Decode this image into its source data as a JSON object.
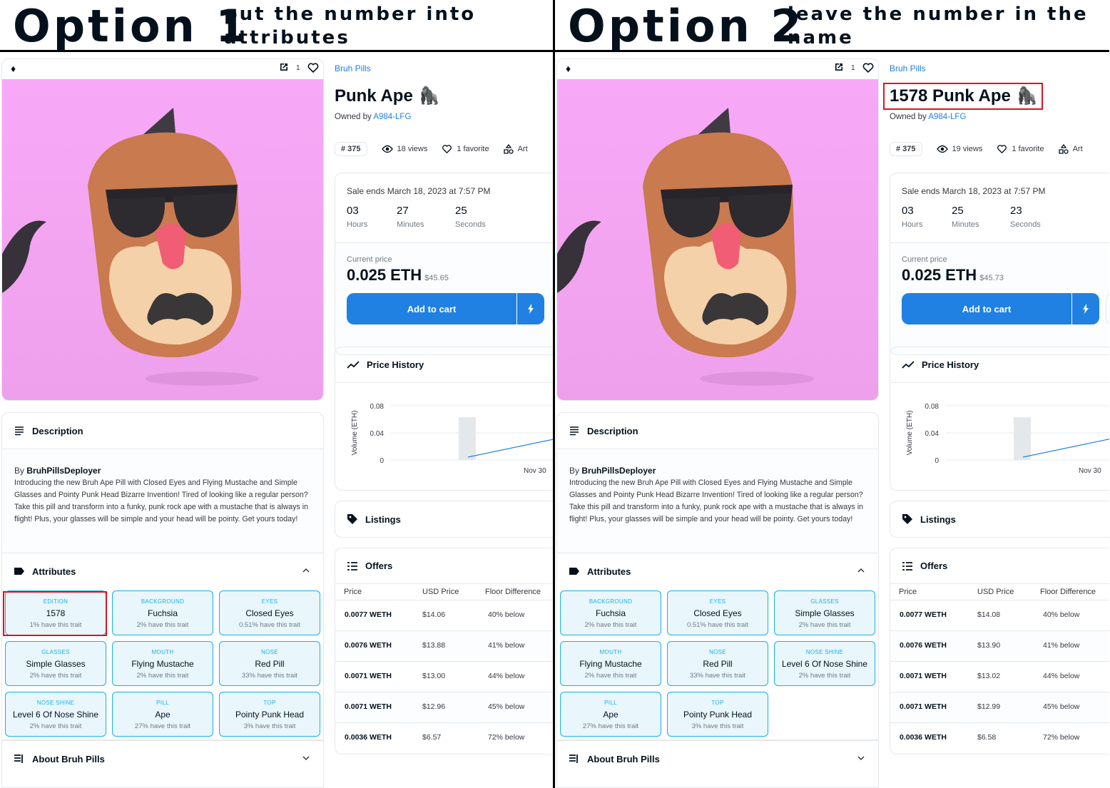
{
  "colors": {
    "accent": "#2081e2",
    "trait_border": "#15b2e5",
    "highlight": "#e0121f",
    "art_bg": "#f7a9f7"
  },
  "options": [
    {
      "title": "Option 1",
      "note": "put the number into attributes",
      "item": {
        "favorites_count": "1",
        "collection": "Bruh Pills",
        "name": "Punk Ape",
        "name_emoji": "🦍",
        "owned_by_label": "Owned by",
        "owner": "A984-LFG",
        "rank": "# 375",
        "views": "18 views",
        "favorites": "1 favorite",
        "category": "Art",
        "sale_ends": "Sale ends March 18, 2023 at 7:57 PM",
        "timer": [
          {
            "value": "03",
            "label": "Hours"
          },
          {
            "value": "27",
            "label": "Minutes"
          },
          {
            "value": "25",
            "label": "Seconds"
          }
        ],
        "current_price_label": "Current price",
        "current_price": "0.025 ETH",
        "current_price_usd": "$45.65",
        "add_to_cart": "Add to cart",
        "price_history": "Price History",
        "listings": "Listings",
        "offers": "Offers",
        "offer_columns": [
          "Price",
          "USD Price",
          "Floor Difference"
        ],
        "offer_rows": [
          {
            "price": "0.0077 WETH",
            "usd": "$14.06",
            "floor": "40% below"
          },
          {
            "price": "0.0076 WETH",
            "usd": "$13.88",
            "floor": "41% below"
          },
          {
            "price": "0.0071 WETH",
            "usd": "$13.00",
            "floor": "44% below"
          },
          {
            "price": "0.0071 WETH",
            "usd": "$12.96",
            "floor": "45% below"
          },
          {
            "price": "0.0036 WETH",
            "usd": "$6.57",
            "floor": "72% below"
          }
        ],
        "description_title": "Description",
        "by_label": "By",
        "creator": "BruhPillsDeployer",
        "description": "Introducing the new Bruh Ape Pill with Closed Eyes and Flying Mustache and Simple Glasses and Pointy Punk Head Bizarre Invention! Tired of looking like a regular person? Take this pill and transform into a funky, punk rock ape with a mustache that is always in flight! Plus, your glasses will be simple and your head will be pointy. Get yours today!",
        "attributes_title": "Attributes",
        "attributes": [
          {
            "type": "EDITION",
            "value": "1578",
            "rarity": "1% have this trait"
          },
          {
            "type": "BACKGROUND",
            "value": "Fuchsia",
            "rarity": "2% have this trait"
          },
          {
            "type": "EYES",
            "value": "Closed Eyes",
            "rarity": "0.51% have this trait"
          },
          {
            "type": "GLASSES",
            "value": "Simple Glasses",
            "rarity": "2% have this trait"
          },
          {
            "type": "MOUTH",
            "value": "Flying Mustache",
            "rarity": "2% have this trait"
          },
          {
            "type": "NOSE",
            "value": "Red Pill",
            "rarity": "33% have this trait"
          },
          {
            "type": "NOSE SHINE",
            "value": "Level 6 Of Nose Shine",
            "rarity": "2% have this trait"
          },
          {
            "type": "PILL",
            "value": "Ape",
            "rarity": "27% have this trait"
          },
          {
            "type": "TOP",
            "value": "Pointy Punk Head",
            "rarity": "3% have this trait"
          }
        ],
        "about_title": "About Bruh Pills"
      }
    },
    {
      "title": "Option 2",
      "note": "leave the number in the name",
      "item": {
        "favorites_count": "1",
        "collection": "Bruh Pills",
        "name": "1578  Punk Ape",
        "name_emoji": "🦍",
        "owned_by_label": "Owned by",
        "owner": "A984-LFG",
        "rank": "# 375",
        "views": "19 views",
        "favorites": "1 favorite",
        "category": "Art",
        "sale_ends": "Sale ends March 18, 2023 at 7:57 PM",
        "timer": [
          {
            "value": "03",
            "label": "Hours"
          },
          {
            "value": "25",
            "label": "Minutes"
          },
          {
            "value": "23",
            "label": "Seconds"
          }
        ],
        "current_price_label": "Current price",
        "current_price": "0.025 ETH",
        "current_price_usd": "$45.73",
        "add_to_cart": "Add to cart",
        "price_history": "Price History",
        "listings": "Listings",
        "offers": "Offers",
        "offer_columns": [
          "Price",
          "USD Price",
          "Floor Difference"
        ],
        "offer_rows": [
          {
            "price": "0.0077 WETH",
            "usd": "$14.08",
            "floor": "40% below"
          },
          {
            "price": "0.0076 WETH",
            "usd": "$13.90",
            "floor": "41% below"
          },
          {
            "price": "0.0071 WETH",
            "usd": "$13.02",
            "floor": "44% below"
          },
          {
            "price": "0.0071 WETH",
            "usd": "$12.99",
            "floor": "45% below"
          },
          {
            "price": "0.0036 WETH",
            "usd": "$6.58",
            "floor": "72% below"
          }
        ],
        "description_title": "Description",
        "by_label": "By",
        "creator": "BruhPillsDeployer",
        "description": "Introducing the new Bruh Ape Pill with Closed Eyes and Flying Mustache and Simple Glasses and Pointy Punk Head Bizarre Invention! Tired of looking like a regular person? Take this pill and transform into a funky, punk rock ape with a mustache that is always in flight! Plus, your glasses will be simple and your head will be pointy. Get yours today!",
        "attributes_title": "Attributes",
        "attributes": [
          {
            "type": "BACKGROUND",
            "value": "Fuchsia",
            "rarity": "2% have this trait"
          },
          {
            "type": "EYES",
            "value": "Closed Eyes",
            "rarity": "0.51% have this trait"
          },
          {
            "type": "GLASSES",
            "value": "Simple Glasses",
            "rarity": "2% have this trait"
          },
          {
            "type": "MOUTH",
            "value": "Flying Mustache",
            "rarity": "2% have this trait"
          },
          {
            "type": "NOSE",
            "value": "Red Pill",
            "rarity": "33% have this trait"
          },
          {
            "type": "NOSE SHINE",
            "value": "Level 6 Of Nose Shine",
            "rarity": "2% have this trait"
          },
          {
            "type": "PILL",
            "value": "Ape",
            "rarity": "27% have this trait"
          },
          {
            "type": "TOP",
            "value": "Pointy Punk Head",
            "rarity": "3% have this trait"
          }
        ],
        "about_title": "About Bruh Pills"
      }
    }
  ],
  "chart_data": [
    {
      "type": "bar",
      "title": "Price History",
      "xlabel": "",
      "ylabel": "Volume (ETH)",
      "x_ticks": [
        "Nov 30"
      ],
      "y_ticks": [
        0,
        0.04,
        0.08
      ],
      "ylim": [
        0,
        0.08
      ],
      "grid": true
    },
    {
      "type": "bar",
      "title": "Price History",
      "xlabel": "",
      "ylabel": "Volume (ETH)",
      "x_ticks": [
        "Nov 30"
      ],
      "y_ticks": [
        0,
        0.04,
        0.08
      ],
      "ylim": [
        0,
        0.08
      ],
      "grid": true
    }
  ]
}
